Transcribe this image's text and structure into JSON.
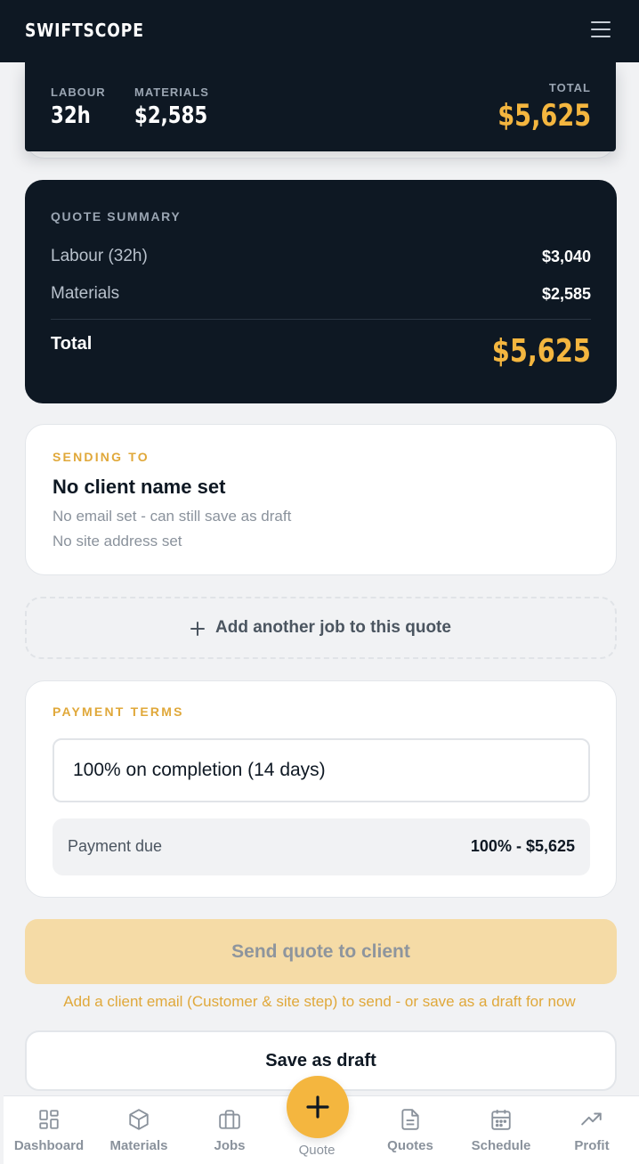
{
  "header": {
    "brand": "SWIFTSCOPE",
    "menu_icon": "hamburger-menu-icon"
  },
  "stats": {
    "labour_label": "LABOUR",
    "labour_value": "32h",
    "materials_label": "MATERIALS",
    "materials_value": "$2,585",
    "total_label": "TOTAL",
    "total_value": "$5,625"
  },
  "summary": {
    "title": "QUOTE SUMMARY",
    "rows": [
      {
        "label": "Labour (32h)",
        "value": "$3,040"
      },
      {
        "label": "Materials",
        "value": "$2,585"
      }
    ],
    "total_label": "Total",
    "total_value": "$5,625"
  },
  "sending_to": {
    "title": "SENDING TO",
    "client_name": "No client name set",
    "email": "No email set - can still save as draft",
    "address": "No site address set"
  },
  "add_job": {
    "icon": "plus-icon",
    "label": "Add another job to this quote"
  },
  "payment_terms": {
    "title": "PAYMENT TERMS",
    "selected": "100% on completion (14 days)",
    "due_label": "Payment due",
    "due_value": "100% - $5,625"
  },
  "actions": {
    "send_label": "Send quote to client",
    "hint": "Add a client email (Customer & site step) to send - or save as a draft for now",
    "draft_label": "Save as draft"
  },
  "nav": {
    "items": [
      {
        "label": "Dashboard",
        "icon": "dashboard-icon"
      },
      {
        "label": "Materials",
        "icon": "box-icon"
      },
      {
        "label": "Jobs",
        "icon": "briefcase-icon"
      },
      {
        "label": "Quote",
        "icon": "plus-icon"
      },
      {
        "label": "Quotes",
        "icon": "document-icon"
      },
      {
        "label": "Schedule",
        "icon": "calendar-icon"
      },
      {
        "label": "Profit",
        "icon": "trending-up-icon"
      }
    ]
  },
  "colors": {
    "navy": "#0e1823",
    "accent": "#f4b63f",
    "eyebrow": "#e0a83a"
  }
}
